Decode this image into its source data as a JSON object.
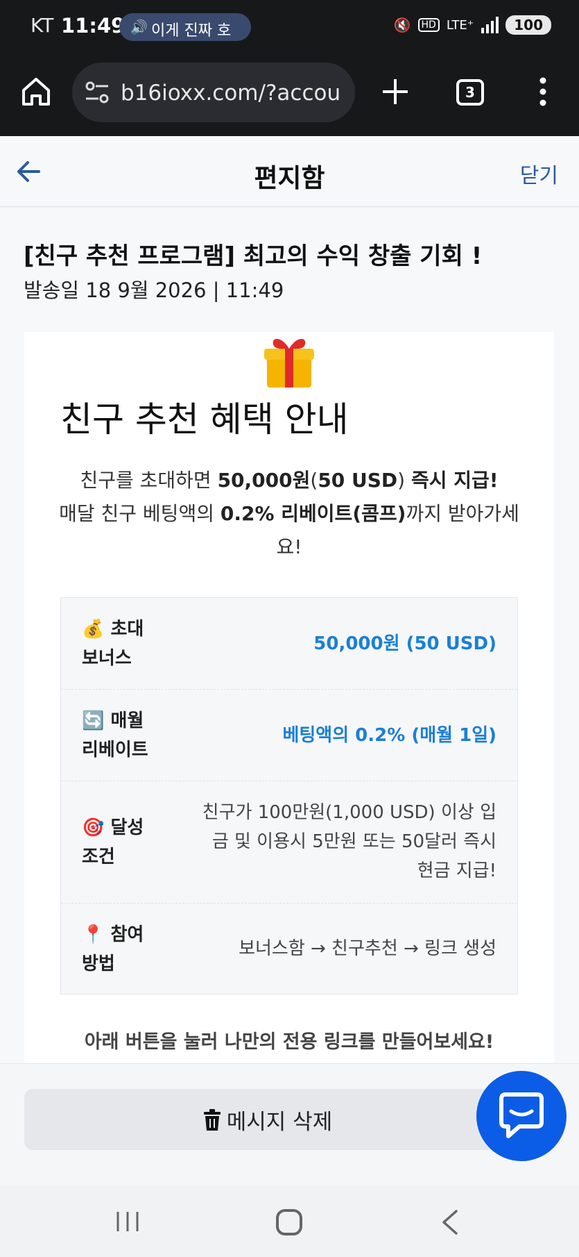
{
  "status_bar": {
    "carrier": "KT",
    "time": "11:49",
    "media_label": "이게 진짜 호",
    "network": "LTE⁺",
    "battery": "100"
  },
  "browser": {
    "url": "b16ioxx.com/?accou",
    "tab_count": "3"
  },
  "header": {
    "title": "편지함",
    "close_label": "닫기"
  },
  "message": {
    "subject": "[친구 추천 프로그램] 최고의 수익 창출 기회 !",
    "date": "발송일 18 9월 2026 | 11:49"
  },
  "card": {
    "heading": "친구 추천 혜택 안내",
    "desc_1a": "친구를 초대하면 ",
    "desc_1b": "50,000원",
    "desc_1c": "(",
    "desc_1d": "50 USD",
    "desc_1e": ") ",
    "desc_1f": "즉시 지급!",
    "desc_2a": "매달 친구 베팅액의 ",
    "desc_2b": "0.2% 리베이트(콤프)",
    "desc_2c": "까지 받아가세요!",
    "rows": [
      {
        "icon": "💰",
        "label": "초대 보너스",
        "value": "50,000원 (50 USD)"
      },
      {
        "icon": "🔄",
        "label": "매월 리베이트",
        "value": "베팅액의 0.2% (매월 1일)"
      },
      {
        "icon": "🎯",
        "label": "달성 조건",
        "value": "친구가 100만원(1,000 USD) 이상 입금 및 이용시 5만원 또는 50달러 즉시 현금 지급!"
      },
      {
        "icon": "📍",
        "label": "참여 방법",
        "value": "보너스함 → 친구추천 → 링크 생성"
      }
    ],
    "cta": "아래 버튼을 눌러 나만의 전용 링크를 만들어보세요!"
  },
  "actions": {
    "delete_label": "메시지 삭제"
  },
  "colors": {
    "accent": "#1b7fd6",
    "fab": "#0b5ce6",
    "link": "#2a5a9e"
  }
}
